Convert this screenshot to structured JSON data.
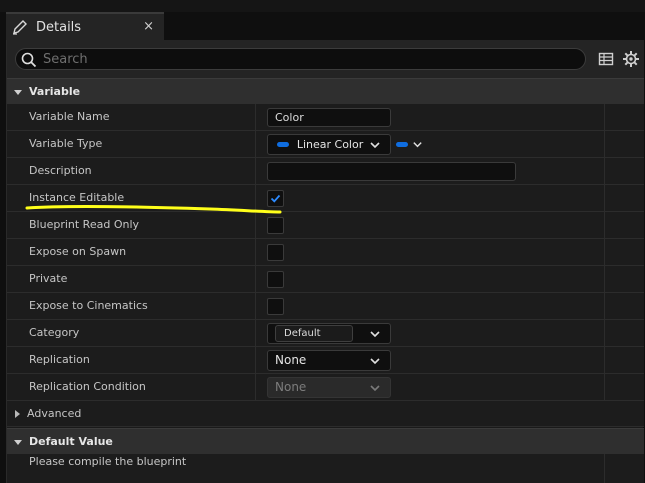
{
  "tab": {
    "title": "Details",
    "close": "×",
    "icon": "pencil-icon"
  },
  "search": {
    "placeholder": "Search"
  },
  "sections": {
    "variable": "Variable",
    "advanced": "Advanced",
    "default_value": "Default Value"
  },
  "fields": {
    "variable_name": {
      "label": "Variable Name",
      "value": "Color"
    },
    "variable_type": {
      "label": "Variable Type",
      "value": "Linear Color"
    },
    "description": {
      "label": "Description",
      "value": ""
    },
    "instance_editable": {
      "label": "Instance Editable",
      "checked": true
    },
    "blueprint_read_only": {
      "label": "Blueprint Read Only",
      "checked": false
    },
    "expose_on_spawn": {
      "label": "Expose on Spawn",
      "checked": false
    },
    "private": {
      "label": "Private",
      "checked": false
    },
    "expose_to_cinematics": {
      "label": "Expose to Cinematics",
      "checked": false
    },
    "category": {
      "label": "Category",
      "value": "Default"
    },
    "replication": {
      "label": "Replication",
      "value": "None"
    },
    "replication_condition": {
      "label": "Replication Condition",
      "value": "None"
    }
  },
  "default_value_message": "Please compile the blueprint",
  "colors": {
    "accent_blue": "#0f6de0",
    "highlight": "#ffff1a"
  }
}
